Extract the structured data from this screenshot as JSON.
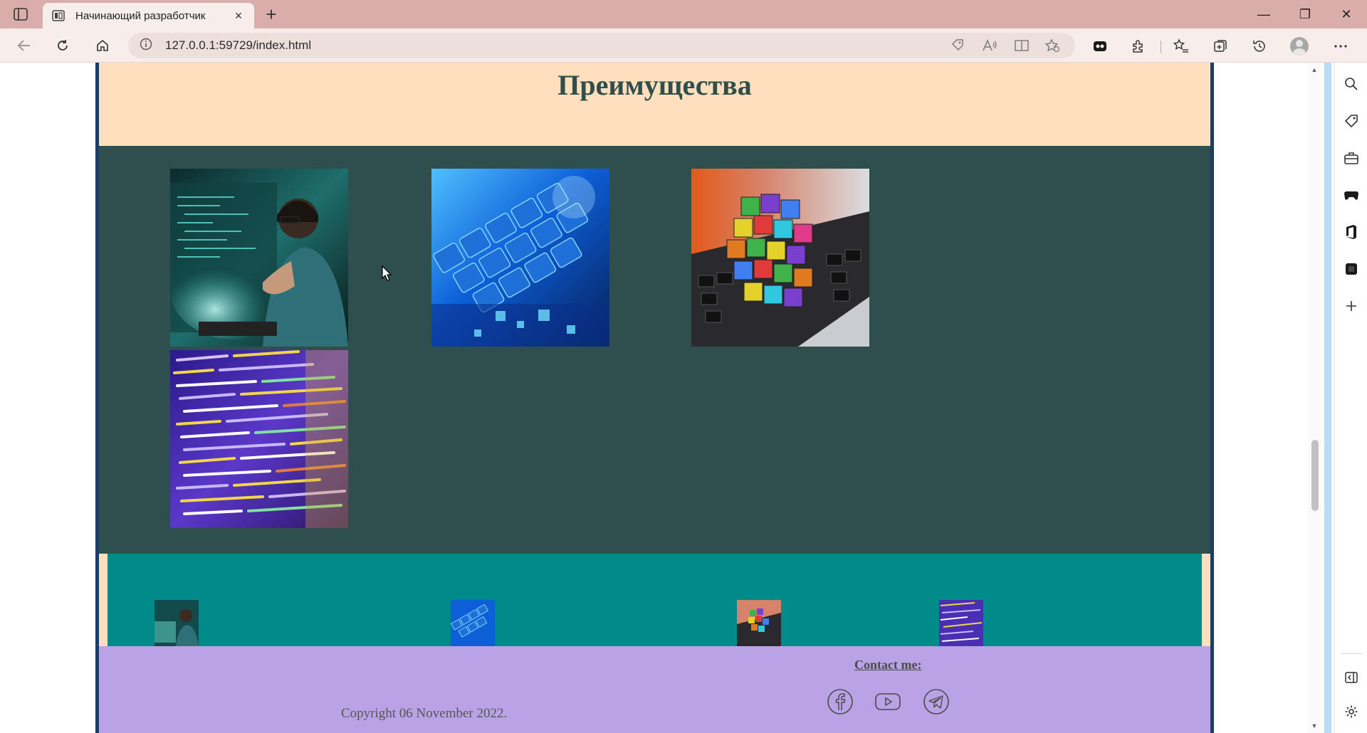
{
  "browser": {
    "tab_title": "Начинающий разработчик",
    "url": "127.0.0.1:59729/index.html",
    "new_tab_symbol": "+",
    "close_symbol": "×",
    "window_buttons": [
      "—",
      "❐",
      "✕"
    ]
  },
  "page": {
    "advantages_title": "Преимущества",
    "images": [
      {
        "name": "developer-at-monitor-photo",
        "palette": [
          "#0f3a3d",
          "#2aa7a0",
          "#101010"
        ]
      },
      {
        "name": "blue-keyboard-photo",
        "palette": [
          "#0a3b9e",
          "#1e7ff0",
          "#6fd0ff"
        ]
      },
      {
        "name": "colorful-cubes-on-laptop-photo",
        "palette": [
          "#e05020",
          "#7b3fd0",
          "#3fb24a"
        ]
      },
      {
        "name": "code-on-screen-photo",
        "palette": [
          "#2b1a8a",
          "#6b3fd6",
          "#d6a83a"
        ]
      }
    ],
    "thumbnails": [
      {
        "name": "thumb-developer"
      },
      {
        "name": "thumb-keyboard"
      },
      {
        "name": "thumb-cubes"
      },
      {
        "name": "thumb-code"
      }
    ],
    "footer": {
      "copyright": "Copyright 06 November 2022.",
      "contact_label": "Contact me:",
      "social": [
        "facebook-icon",
        "youtube-icon",
        "telegram-icon"
      ]
    }
  },
  "colors": {
    "header_bg": "#ffdfbc",
    "grid_bg": "#2f4f4f",
    "thumbs_bg": "#008b8b",
    "footer_bg": "#b9a3e6",
    "title_color": "#2f4f4f",
    "border": "#1c3d6b"
  }
}
